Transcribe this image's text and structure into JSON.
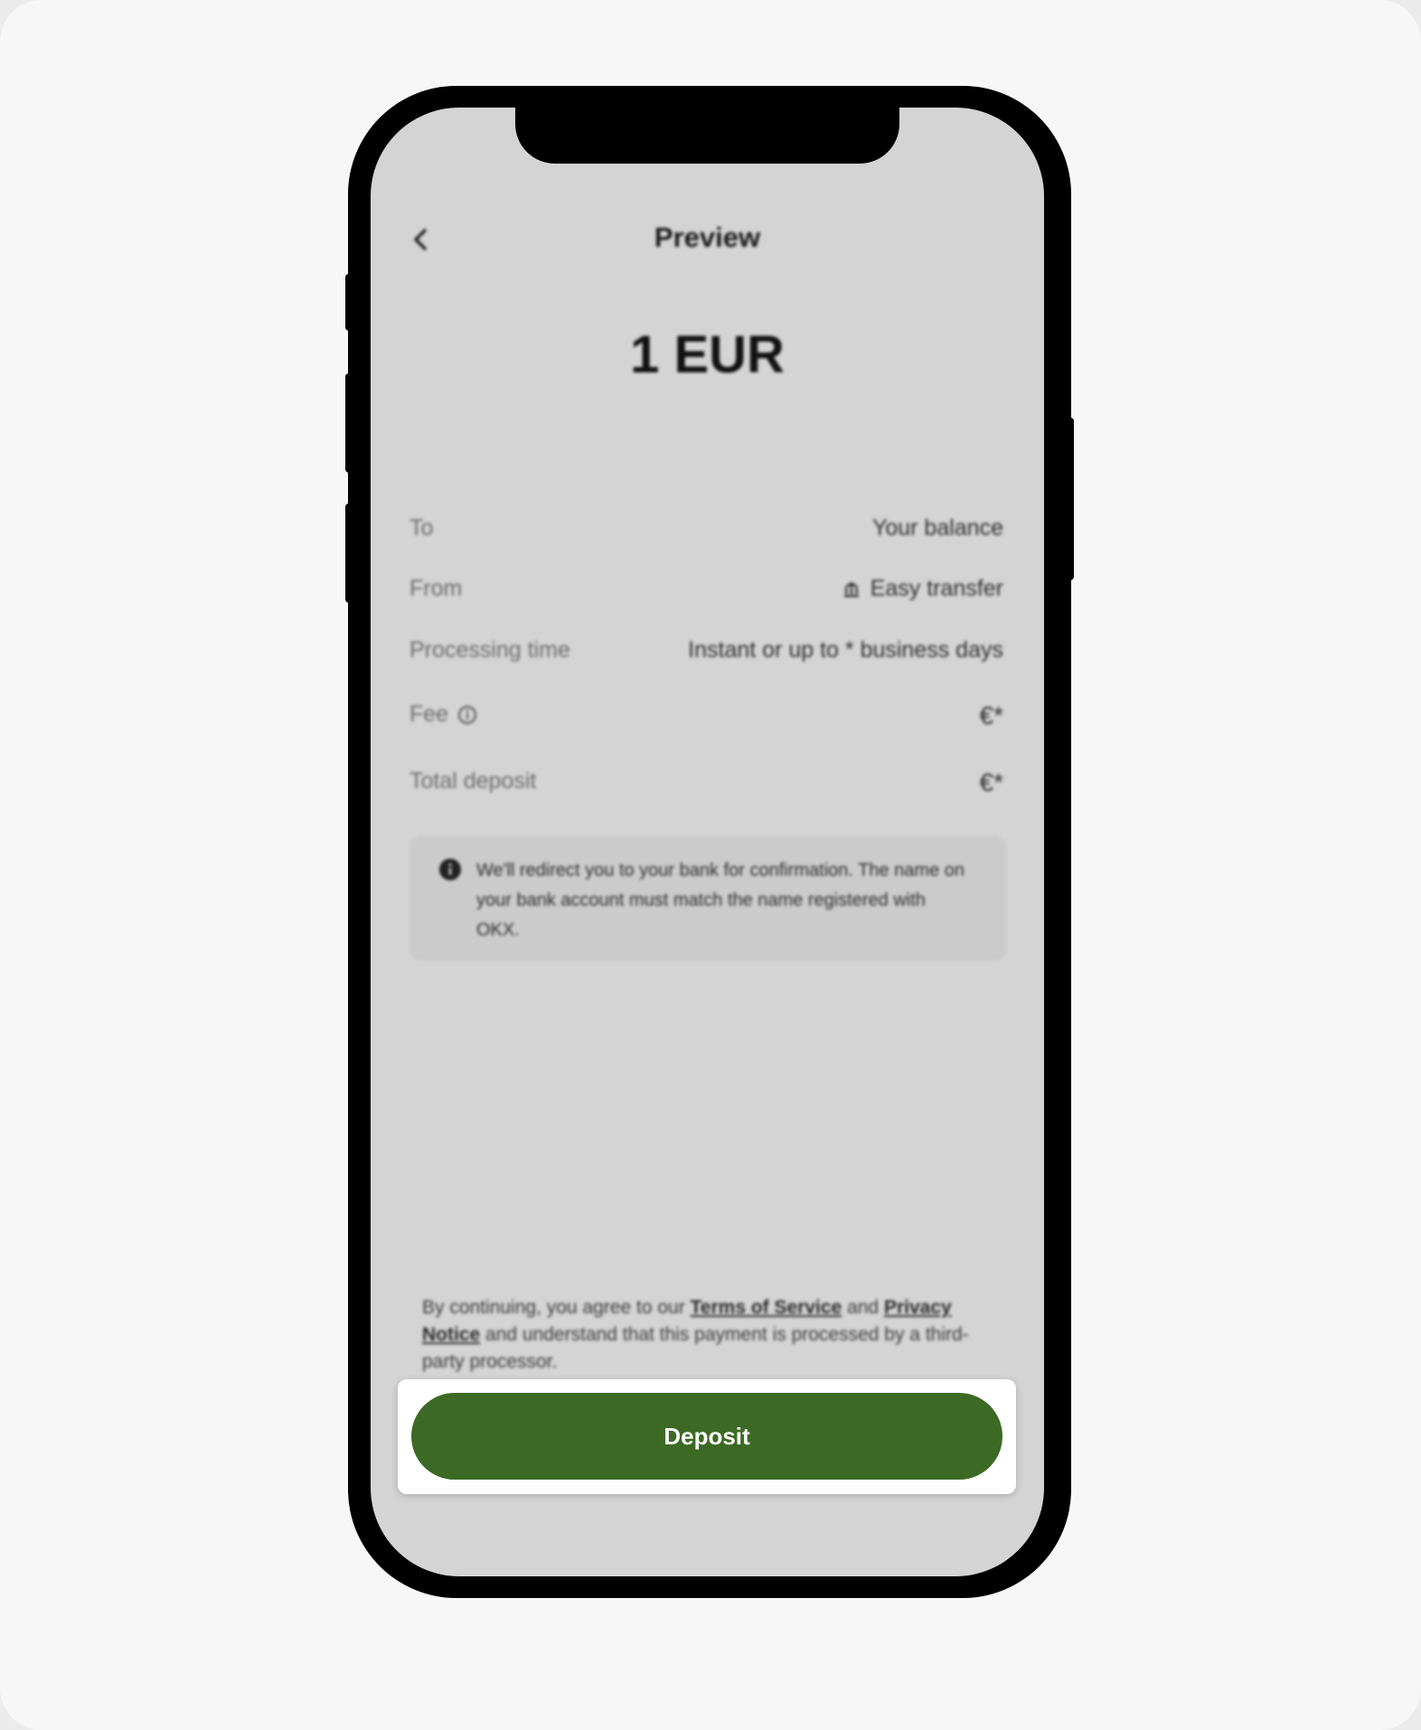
{
  "header": {
    "title": "Preview"
  },
  "amount": "1 EUR",
  "details": {
    "to": {
      "label": "To",
      "value": "Your balance"
    },
    "from": {
      "label": "From",
      "value": "Easy transfer",
      "icon": "bank-icon"
    },
    "processing": {
      "label": "Processing time",
      "value": "Instant or up to * business days"
    },
    "fee": {
      "label": "Fee",
      "value": "€*",
      "icon": "info-circle-icon"
    },
    "total": {
      "label": "Total deposit",
      "value": "€*"
    }
  },
  "notice": {
    "text": "We'll redirect you to your bank for confirmation. The name on your bank account must match the name registered with OKX."
  },
  "terms": {
    "prefix": "By continuing, you agree to our ",
    "terms_link": "Terms of Service",
    "and": " and ",
    "privacy_link": "Privacy Notice",
    "suffix": " and understand that this payment is processed by a third-party processor."
  },
  "deposit_button": {
    "label": "Deposit",
    "color": "#3c6a24"
  }
}
